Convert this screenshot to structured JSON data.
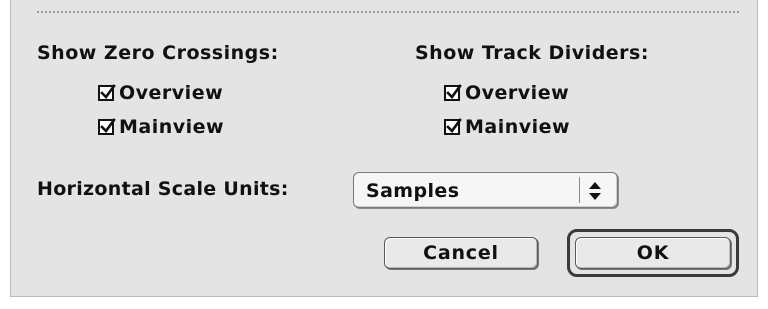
{
  "zero_crossings": {
    "heading": "Show Zero Crossings:",
    "overview_label": "Overview",
    "overview_checked": true,
    "mainview_label": "Mainview",
    "mainview_checked": true
  },
  "track_dividers": {
    "heading": "Show Track Dividers:",
    "overview_label": "Overview",
    "overview_checked": true,
    "mainview_label": "Mainview",
    "mainview_checked": true
  },
  "scale_units": {
    "label": "Horizontal Scale Units:",
    "selected": "Samples"
  },
  "buttons": {
    "cancel_label": "Cancel",
    "ok_label": "OK"
  },
  "icons": {
    "checkbox_mark": "checkmark-icon",
    "select_arrows": "up-down-arrows-icon"
  }
}
